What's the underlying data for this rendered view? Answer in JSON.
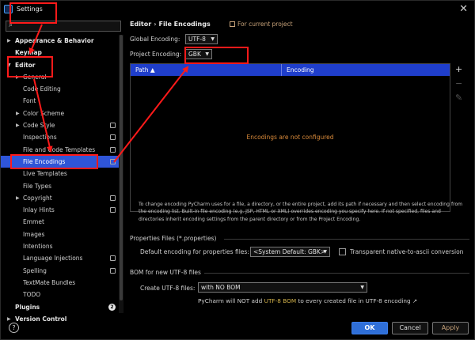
{
  "window": {
    "title": "Settings",
    "close": "✕"
  },
  "search": {
    "placeholder": "",
    "icon": "search-icon"
  },
  "sidebar": {
    "items": [
      {
        "label": "Appearance & Behavior",
        "bold": true,
        "arrow": "▶",
        "indent": 0
      },
      {
        "label": "Keymap",
        "bold": true,
        "arrow": "",
        "indent": 0
      },
      {
        "label": "Editor",
        "bold": true,
        "arrow": "▼",
        "indent": 0
      },
      {
        "label": "General",
        "arrow": "▶",
        "indent": 1
      },
      {
        "label": "Code Editing",
        "arrow": "",
        "indent": 1
      },
      {
        "label": "Font",
        "arrow": "",
        "indent": 1
      },
      {
        "label": "Color Scheme",
        "arrow": "▶",
        "indent": 1
      },
      {
        "label": "Code Style",
        "arrow": "▶",
        "indent": 1,
        "project": true
      },
      {
        "label": "Inspections",
        "arrow": "",
        "indent": 1,
        "project": true
      },
      {
        "label": "File and Code Templates",
        "arrow": "",
        "indent": 1,
        "project": true
      },
      {
        "label": "File Encodings",
        "arrow": "",
        "indent": 1,
        "project": true,
        "selected": true
      },
      {
        "label": "Live Templates",
        "arrow": "",
        "indent": 1
      },
      {
        "label": "File Types",
        "arrow": "",
        "indent": 1
      },
      {
        "label": "Copyright",
        "arrow": "▶",
        "indent": 1,
        "project": true
      },
      {
        "label": "Inlay Hints",
        "arrow": "",
        "indent": 1,
        "project": true
      },
      {
        "label": "Emmet",
        "arrow": "",
        "indent": 1
      },
      {
        "label": "Images",
        "arrow": "",
        "indent": 1
      },
      {
        "label": "Intentions",
        "arrow": "",
        "indent": 1
      },
      {
        "label": "Language Injections",
        "arrow": "",
        "indent": 1,
        "project": true
      },
      {
        "label": "Spelling",
        "arrow": "",
        "indent": 1,
        "project": true
      },
      {
        "label": "TextMate Bundles",
        "arrow": "",
        "indent": 1
      },
      {
        "label": "TODO",
        "arrow": "",
        "indent": 1
      },
      {
        "label": "Plugins",
        "bold": true,
        "arrow": "",
        "indent": 0,
        "badge": "2"
      },
      {
        "label": "Version Control",
        "bold": true,
        "arrow": "▶",
        "indent": 0
      }
    ]
  },
  "main": {
    "breadcrumb": [
      "Editor",
      "File Encodings"
    ],
    "breadcrumb_sep": "›",
    "for_project": "For current project",
    "global_encoding_label": "Global Encoding:",
    "global_encoding_value": "UTF-8",
    "project_encoding_label": "Project Encoding:",
    "project_encoding_value": "GBK",
    "table": {
      "headers": [
        "Path ▲",
        "Encoding"
      ],
      "empty_text": "Encodings are not configured",
      "tools": [
        "+",
        "−",
        "✎"
      ]
    },
    "help_text": "To change encoding PyCharm uses for a file, a directory, or the entire project, add its path if necessary and then select encoding from the encoding list. Built-in file encoding (e.g. JSP, HTML or XML) overrides encoding you specify here. If not specified, files and directories inherit encoding settings from the parent directory or from the Project Encoding.",
    "properties": {
      "section": "Properties Files (*.properties)",
      "default_label": "Default encoding for properties files:",
      "default_value": "<System Default: GBK>",
      "native_label": "Transparent native-to-ascii conversion"
    },
    "bom": {
      "section": "BOM for new UTF-8 files",
      "create_label": "Create UTF-8 files:",
      "create_value": "with NO BOM",
      "note_prefix": "PyCharm will NOT add ",
      "note_link": "UTF-8 BOM",
      "note_suffix": " to every created file in UTF-8 encoding ↗"
    }
  },
  "footer": {
    "help": "?",
    "ok": "OK",
    "cancel": "Cancel",
    "apply": "Apply"
  },
  "colors": {
    "selection": "#2f55d8",
    "table_header": "#1f3ecb",
    "annotation": "#ff1a1a",
    "ok_button": "#2f6fd8",
    "warning_text": "#d98a3a"
  }
}
